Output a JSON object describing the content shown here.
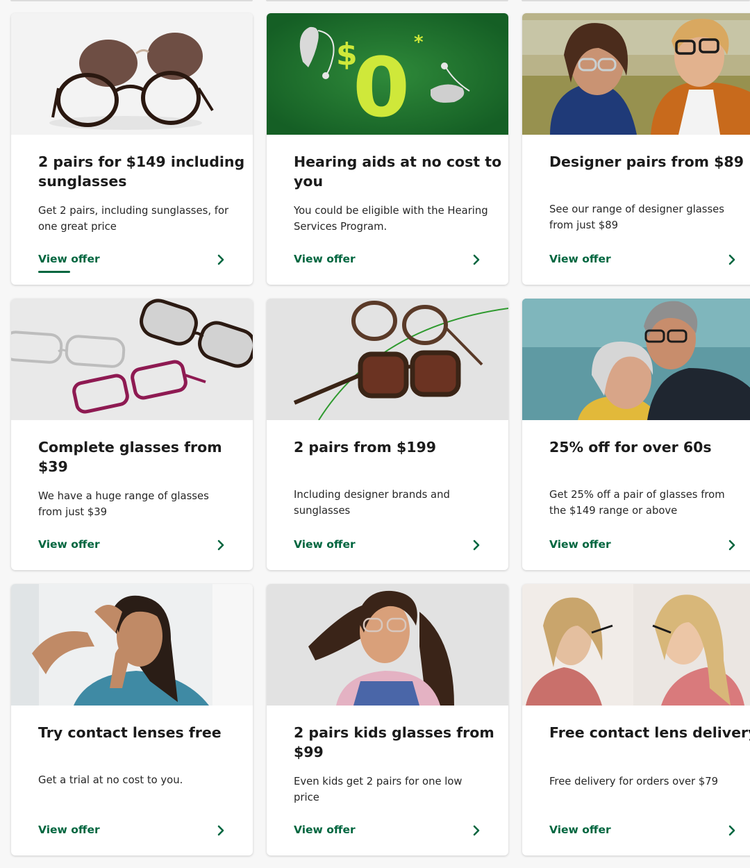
{
  "colors": {
    "page_background": "#f7f7f7",
    "card_background": "#ffffff",
    "heading_text": "#1b1b1b",
    "body_text": "#262626",
    "cta_green": "#00663f",
    "promo_green": "#1a6b2b",
    "promo_lime": "#cfe83a"
  },
  "offers": [
    {
      "title": "2 pairs for $149 including sunglasses",
      "description": "Get 2 pairs, including sunglasses, for one great price",
      "cta": "View offer",
      "image": "two-pairs-glasses-sunglasses-photo"
    },
    {
      "title": "Hearing aids at no cost to you",
      "description": "You could be eligible with the Hearing Services Program.",
      "cta": "View offer",
      "image": "hearing-aids-promo-graphic",
      "image_text": {
        "dollar": "$",
        "amount": "0",
        "asterisk": "*"
      }
    },
    {
      "title": "Designer pairs from $89",
      "description": "See our range of designer glasses from just $89",
      "cta": "View offer",
      "image": "couple-wearing-glasses-photo"
    },
    {
      "title": "Complete glasses from $39",
      "description": "We have a huge range of glasses from just $39",
      "cta": "View offer",
      "image": "assorted-frames-photo"
    },
    {
      "title": "2 pairs from $199",
      "description": "Including designer brands and sunglasses",
      "cta": "View offer",
      "image": "designer-frames-photo"
    },
    {
      "title": "25% off for over 60s",
      "description": "Get 25% off a pair of glasses from the $149 range or above",
      "cta": "View offer",
      "image": "senior-couple-photo"
    },
    {
      "title": "Try contact lenses free",
      "description": "Get a trial at no cost to you.",
      "cta": "View offer",
      "image": "woman-inserting-contact-lens-photo"
    },
    {
      "title": "2 pairs kids glasses from $99",
      "description": "Even kids get 2 pairs for one low price",
      "cta": "View offer",
      "image": "girl-wearing-glasses-photo"
    },
    {
      "title": "Free contact lens delivery",
      "description": "Free delivery for orders over $79",
      "cta": "View offer",
      "image": "woman-applying-mascara-mirror-photo"
    }
  ],
  "icons": {
    "cta_arrow": "chevron-right-icon"
  }
}
